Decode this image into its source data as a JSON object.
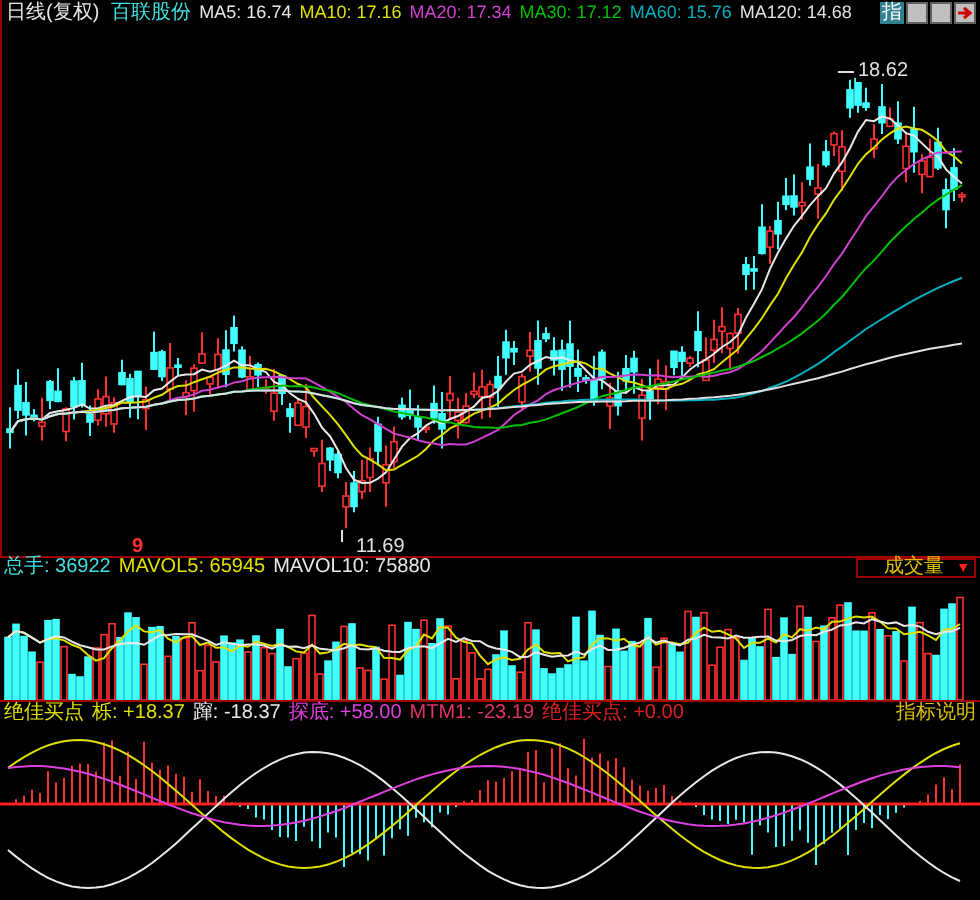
{
  "header": {
    "period": "日线(复权)",
    "stock_name": "百联股份",
    "ma": [
      {
        "label": "MA5: 16.74",
        "color": "#e8e8e8"
      },
      {
        "label": "MA10: 17.16",
        "color": "#e0e000"
      },
      {
        "label": "MA20: 17.34",
        "color": "#d040d0"
      },
      {
        "label": "MA30: 17.12",
        "color": "#00c000"
      },
      {
        "label": "MA60: 15.76",
        "color": "#00b0c0"
      },
      {
        "label": "MA120: 14.68",
        "color": "#e0e0e0"
      }
    ]
  },
  "toolbar": {
    "label": "指"
  },
  "main_chart": {
    "high_label": "18.62",
    "low_label": "11.69",
    "marker": "9"
  },
  "volume": {
    "items": [
      {
        "label": "总手: 36922",
        "color": "#40e0e0"
      },
      {
        "label": "MAVOL5: 65945",
        "color": "#e0e000"
      },
      {
        "label": "MAVOL10: 75880",
        "color": "#e8e8e8"
      }
    ],
    "dropdown": "成交量",
    "dropdown_arrow": "▼"
  },
  "indicator": {
    "items": [
      {
        "label": "绝佳买点",
        "color": "#e0e000"
      },
      {
        "label": "栎: +18.37",
        "color": "#e0e000"
      },
      {
        "label": "蹿: -18.37",
        "color": "#e8e8e8"
      },
      {
        "label": "探底: +58.00",
        "color": "#e040e0"
      },
      {
        "label": "MTM1: -23.19",
        "color": "#e03070"
      },
      {
        "label": "绝佳买点: +0.00",
        "color": "#e02020"
      }
    ],
    "help": "指标说明"
  }
}
